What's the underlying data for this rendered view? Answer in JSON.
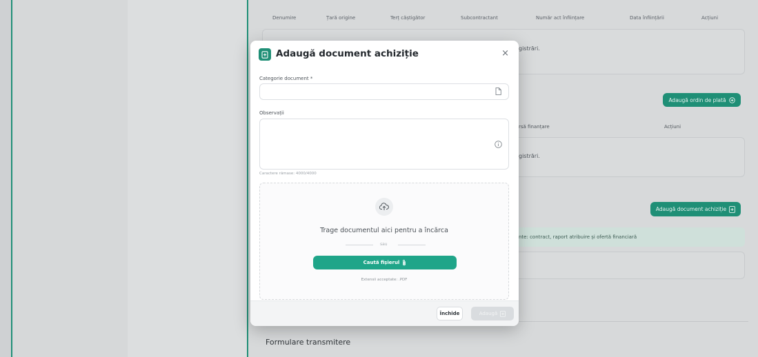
{
  "background": {
    "table_headers": [
      "Denumire",
      "Țară origine",
      "Terț căștigător",
      "Subcontractant",
      "Număr act înființare",
      "Data înființării",
      "Acțiuni"
    ],
    "empty_text_1": "gistrări.",
    "empty_text_2": "gistrări.",
    "add_payment_button": "Adaugă ordin de plată",
    "payment_col_financing": "rsă finanțare",
    "payment_col_actions": "Acțiuni",
    "add_document_button": "Adaugă document achiziție",
    "info_text": "nte: contract, raport atribuire și ofertă financiară",
    "section_title": "Formulare transmitere"
  },
  "modal": {
    "title": "Adaugă document achiziție",
    "close_symbol": "×",
    "category_label": "Categorie document *",
    "category_value": "",
    "observations_label": "Observații",
    "observations_value": "",
    "char_hint": "Caractere rămase: 4000/4000",
    "drop_text": "Trage documentul aici pentru a încărca",
    "or_text": "sau",
    "search_button": "Caută fișierul",
    "extensions_text": "Extensii acceptate: .PDF",
    "close_button": "Închide",
    "add_button": "Adaugă"
  },
  "colors": {
    "accent": "#1f8f76",
    "primary_button": "#1fa589"
  }
}
